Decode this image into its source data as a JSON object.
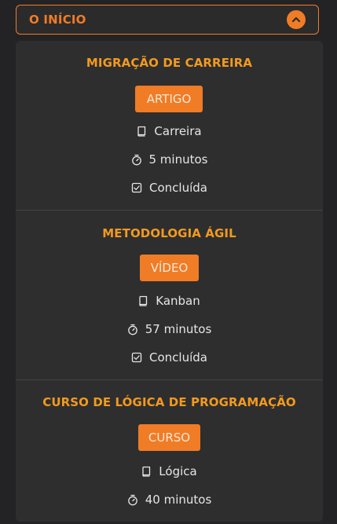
{
  "header": {
    "title": "O INÍCIO",
    "toggle_icon": "chevron-up-icon",
    "accent_color": "#f07c26"
  },
  "cards": [
    {
      "title": "MIGRAÇÃO DE CARREIRA",
      "type": "ARTIGO",
      "category": "Carreira",
      "duration": "5 minutos",
      "status": "Concluída"
    },
    {
      "title": "METODOLOGIA ÁGIL",
      "type": "VÍDEO",
      "category": "Kanban",
      "duration": "57 minutos",
      "status": "Concluída"
    },
    {
      "title": "CURSO DE LÓGICA DE PROGRAMAÇÃO",
      "type": "CURSO",
      "category": "Lógica",
      "duration": "40 minutos"
    }
  ],
  "icons": {
    "category": "book-icon",
    "duration": "stopwatch-icon",
    "status": "check-square-icon"
  }
}
